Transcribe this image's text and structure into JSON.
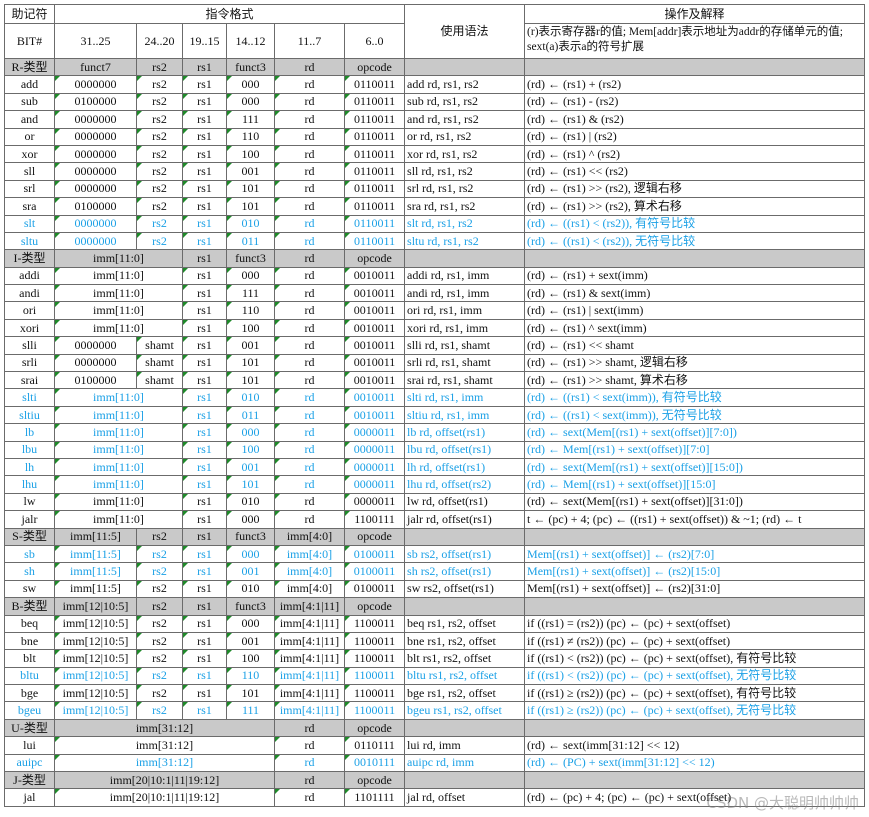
{
  "header": {
    "mnemonic": "助记符",
    "format": "指令格式",
    "syntax": "使用语法",
    "operation": "操作及解释",
    "bit_label": "BIT#",
    "bits": [
      "31..25",
      "24..20",
      "19..15",
      "14..12",
      "11..7",
      "6..0"
    ],
    "operation_note": "(r)表示寄存器r的值; Mem[addr]表示地址为addr的存储单元的值; sext(a)表示a的符号扩展"
  },
  "rows": [
    {
      "kind": "sec",
      "c": [
        "R-类型",
        "funct7",
        "rs2",
        "rs1",
        "funct3",
        "rd",
        "opcode",
        "",
        ""
      ]
    },
    {
      "kind": "row",
      "c": [
        "add",
        "0000000",
        "rs2",
        "rs1",
        "000",
        "rd",
        "0110011",
        "add rd, rs1, rs2",
        "(rd) ← (rs1) + (rs2)"
      ]
    },
    {
      "kind": "row",
      "c": [
        "sub",
        "0100000",
        "rs2",
        "rs1",
        "000",
        "rd",
        "0110011",
        "sub rd, rs1, rs2",
        "(rd) ← (rs1) - (rs2)"
      ]
    },
    {
      "kind": "row",
      "c": [
        "and",
        "0000000",
        "rs2",
        "rs1",
        "111",
        "rd",
        "0110011",
        "and rd, rs1, rs2",
        "(rd) ← (rs1) & (rs2)"
      ]
    },
    {
      "kind": "row",
      "c": [
        "or",
        "0000000",
        "rs2",
        "rs1",
        "110",
        "rd",
        "0110011",
        "or rd, rs1, rs2",
        "(rd) ← (rs1) | (rs2)"
      ]
    },
    {
      "kind": "row",
      "c": [
        "xor",
        "0000000",
        "rs2",
        "rs1",
        "100",
        "rd",
        "0110011",
        "xor rd, rs1, rs2",
        "(rd) ← (rs1) ^ (rs2)"
      ]
    },
    {
      "kind": "row",
      "c": [
        "sll",
        "0000000",
        "rs2",
        "rs1",
        "001",
        "rd",
        "0110011",
        "sll rd, rs1, rs2",
        "(rd) ← (rs1) << (rs2)"
      ]
    },
    {
      "kind": "row",
      "c": [
        "srl",
        "0000000",
        "rs2",
        "rs1",
        "101",
        "rd",
        "0110011",
        "srl rd, rs1, rs2",
        "(rd) ← (rs1) >> (rs2), 逻辑右移"
      ]
    },
    {
      "kind": "row",
      "c": [
        "sra",
        "0100000",
        "rs2",
        "rs1",
        "101",
        "rd",
        "0110011",
        "sra rd, rs1, rs2",
        "(rd) ← (rs1) >> (rs2), 算术右移"
      ]
    },
    {
      "kind": "hl",
      "c": [
        "slt",
        "0000000",
        "rs2",
        "rs1",
        "010",
        "rd",
        "0110011",
        "slt rd, rs1, rs2",
        "(rd) ← ((rs1) < (rs2)), 有符号比较"
      ]
    },
    {
      "kind": "hl",
      "c": [
        "sltu",
        "0000000",
        "rs2",
        "rs1",
        "011",
        "rd",
        "0110011",
        "sltu rd, rs1, rs2",
        "(rd) ← ((rs1) < (rs2)), 无符号比较"
      ]
    },
    {
      "kind": "secI",
      "c": [
        "I-类型",
        "imm[11:0]",
        "rs1",
        "funct3",
        "rd",
        "opcode",
        "",
        ""
      ]
    },
    {
      "kind": "rowI",
      "c": [
        "addi",
        "imm[11:0]",
        "rs1",
        "000",
        "rd",
        "0010011",
        "addi rd, rs1, imm",
        "(rd) ← (rs1) + sext(imm)"
      ]
    },
    {
      "kind": "rowI",
      "c": [
        "andi",
        "imm[11:0]",
        "rs1",
        "111",
        "rd",
        "0010011",
        "andi rd, rs1, imm",
        "(rd) ← (rs1) & sext(imm)"
      ]
    },
    {
      "kind": "rowI",
      "c": [
        "ori",
        "imm[11:0]",
        "rs1",
        "110",
        "rd",
        "0010011",
        "ori rd, rs1, imm",
        "(rd) ← (rs1) | sext(imm)"
      ]
    },
    {
      "kind": "rowI",
      "c": [
        "xori",
        "imm[11:0]",
        "rs1",
        "100",
        "rd",
        "0010011",
        "xori rd, rs1, imm",
        "(rd) ← (rs1) ^ sext(imm)"
      ]
    },
    {
      "kind": "row",
      "c": [
        "slli",
        "0000000",
        "shamt",
        "rs1",
        "001",
        "rd",
        "0010011",
        "slli rd, rs1, shamt",
        "(rd) ← (rs1) << shamt"
      ]
    },
    {
      "kind": "row",
      "c": [
        "srli",
        "0000000",
        "shamt",
        "rs1",
        "101",
        "rd",
        "0010011",
        "srli rd, rs1, shamt",
        "(rd) ← (rs1) >> shamt, 逻辑右移"
      ]
    },
    {
      "kind": "row",
      "c": [
        "srai",
        "0100000",
        "shamt",
        "rs1",
        "101",
        "rd",
        "0010011",
        "srai rd, rs1, shamt",
        "(rd) ← (rs1) >> shamt, 算术右移"
      ]
    },
    {
      "kind": "hlI",
      "c": [
        "slti",
        "imm[11:0]",
        "rs1",
        "010",
        "rd",
        "0010011",
        "slti rd, rs1, imm",
        "(rd) ← ((rs1) < sext(imm)), 有符号比较"
      ]
    },
    {
      "kind": "hlI",
      "c": [
        "sltiu",
        "imm[11:0]",
        "rs1",
        "011",
        "rd",
        "0010011",
        "sltiu rd, rs1, imm",
        "(rd) ← ((rs1) < sext(imm)), 无符号比较"
      ]
    },
    {
      "kind": "hlI",
      "c": [
        "lb",
        "imm[11:0]",
        "rs1",
        "000",
        "rd",
        "0000011",
        "lb rd, offset(rs1)",
        "(rd) ← sext(Mem[(rs1) + sext(offset)][7:0])"
      ]
    },
    {
      "kind": "hlI",
      "c": [
        "lbu",
        "imm[11:0]",
        "rs1",
        "100",
        "rd",
        "0000011",
        "lbu rd, offset(rs1)",
        "(rd) ← Mem[(rs1) + sext(offset)][7:0]"
      ]
    },
    {
      "kind": "hlI",
      "c": [
        "lh",
        "imm[11:0]",
        "rs1",
        "001",
        "rd",
        "0000011",
        "lh rd, offset(rs1)",
        "(rd) ← sext(Mem[(rs1) + sext(offset)][15:0])"
      ]
    },
    {
      "kind": "hlI",
      "c": [
        "lhu",
        "imm[11:0]",
        "rs1",
        "101",
        "rd",
        "0000011",
        "lhu rd, offset(rs2)",
        "(rd) ← Mem[(rs1) + sext(offset)][15:0]"
      ]
    },
    {
      "kind": "rowI",
      "c": [
        "lw",
        "imm[11:0]",
        "rs1",
        "010",
        "rd",
        "0000011",
        "lw rd, offset(rs1)",
        "(rd) ← sext(Mem[(rs1) + sext(offset)][31:0])"
      ]
    },
    {
      "kind": "rowI",
      "c": [
        "jalr",
        "imm[11:0]",
        "rs1",
        "000",
        "rd",
        "1100111",
        "jalr rd, offset(rs1)",
        "t ← (pc) + 4; (pc) ← ((rs1) + sext(offset)) & ~1; (rd) ← t"
      ]
    },
    {
      "kind": "sec",
      "c": [
        "S-类型",
        "imm[11:5]",
        "rs2",
        "rs1",
        "funct3",
        "imm[4:0]",
        "opcode",
        "",
        ""
      ]
    },
    {
      "kind": "hl",
      "c": [
        "sb",
        "imm[11:5]",
        "rs2",
        "rs1",
        "000",
        "imm[4:0]",
        "0100011",
        "sb rs2, offset(rs1)",
        "Mem[(rs1) + sext(offset)] ← (rs2)[7:0]"
      ]
    },
    {
      "kind": "hl",
      "c": [
        "sh",
        "imm[11:5]",
        "rs2",
        "rs1",
        "001",
        "imm[4:0]",
        "0100011",
        "sh rs2, offset(rs1)",
        "Mem[(rs1) + sext(offset)] ← (rs2)[15:0]"
      ]
    },
    {
      "kind": "row",
      "c": [
        "sw",
        "imm[11:5]",
        "rs2",
        "rs1",
        "010",
        "imm[4:0]",
        "0100011",
        "sw rs2, offset(rs1)",
        "Mem[(rs1) + sext(offset)] ← (rs2)[31:0]"
      ]
    },
    {
      "kind": "sec",
      "c": [
        "B-类型",
        "imm[12|10:5]",
        "rs2",
        "rs1",
        "funct3",
        "imm[4:1|11]",
        "opcode",
        "",
        ""
      ]
    },
    {
      "kind": "row",
      "c": [
        "beq",
        "imm[12|10:5]",
        "rs2",
        "rs1",
        "000",
        "imm[4:1|11]",
        "1100011",
        "beq rs1, rs2, offset",
        "if ((rs1) = (rs2)) (pc) ← (pc) + sext(offset)"
      ]
    },
    {
      "kind": "row",
      "c": [
        "bne",
        "imm[12|10:5]",
        "rs2",
        "rs1",
        "001",
        "imm[4:1|11]",
        "1100011",
        "bne rs1, rs2, offset",
        "if ((rs1) ≠ (rs2)) (pc) ← (pc) + sext(offset)"
      ]
    },
    {
      "kind": "row",
      "c": [
        "blt",
        "imm[12|10:5]",
        "rs2",
        "rs1",
        "100",
        "imm[4:1|11]",
        "1100011",
        "blt rs1, rs2, offset",
        "if ((rs1) < (rs2)) (pc) ← (pc) + sext(offset), 有符号比较"
      ]
    },
    {
      "kind": "hl",
      "c": [
        "bltu",
        "imm[12|10:5]",
        "rs2",
        "rs1",
        "110",
        "imm[4:1|11]",
        "1100011",
        "bltu rs1, rs2, offset",
        "if ((rs1) < (rs2)) (pc) ← (pc) + sext(offset), 无符号比较"
      ]
    },
    {
      "kind": "row",
      "c": [
        "bge",
        "imm[12|10:5]",
        "rs2",
        "rs1",
        "101",
        "imm[4:1|11]",
        "1100011",
        "bge rs1, rs2, offset",
        "if ((rs1) ≥ (rs2)) (pc) ← (pc) + sext(offset), 有符号比较"
      ]
    },
    {
      "kind": "hl",
      "c": [
        "bgeu",
        "imm[12|10:5]",
        "rs2",
        "rs1",
        "111",
        "imm[4:1|11]",
        "1100011",
        "bgeu rs1, rs2, offset",
        "if ((rs1) ≥ (rs2)) (pc) ← (pc) + sext(offset), 无符号比较"
      ]
    },
    {
      "kind": "secU",
      "c": [
        "U-类型",
        "imm[31:12]",
        "rd",
        "opcode",
        "",
        ""
      ]
    },
    {
      "kind": "rowU",
      "c": [
        "lui",
        "imm[31:12]",
        "rd",
        "0110111",
        "lui rd, imm",
        "(rd) ← sext(imm[31:12] << 12)"
      ]
    },
    {
      "kind": "hlU",
      "c": [
        "auipc",
        "imm[31:12]",
        "rd",
        "0010111",
        "auipc rd, imm",
        "(rd) ← (PC) + sext(imm[31:12] << 12)"
      ]
    },
    {
      "kind": "secU",
      "c": [
        "J-类型",
        "imm[20|10:1|11|19:12]",
        "rd",
        "opcode",
        "",
        ""
      ]
    },
    {
      "kind": "rowU",
      "c": [
        "jal",
        "imm[20|10:1|11|19:12]",
        "rd",
        "1101111",
        "jal rd, offset",
        "(rd) ← (pc) + 4; (pc) ← (pc) + sext(offset)"
      ]
    }
  ],
  "watermark": "CSDN @大聪明帅帅帅",
  "colors": {
    "highlight": "#1aa0e6",
    "section_bg": "#c9c9c9",
    "marker": "#1f8a2a"
  }
}
